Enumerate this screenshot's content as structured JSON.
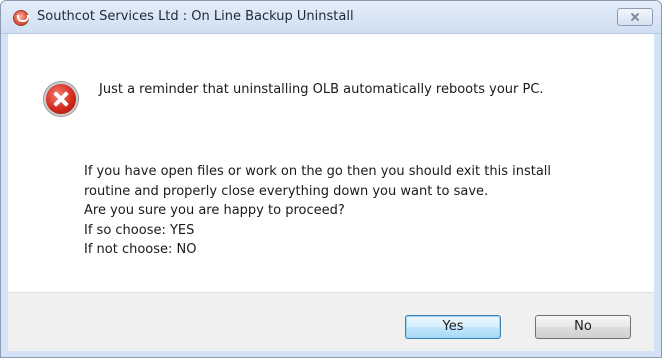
{
  "window": {
    "title": "Southcot Services Ltd : On Line Backup Uninstall",
    "icon": "app-icon"
  },
  "titlebar": {
    "close_icon": "close-icon"
  },
  "message": {
    "icon": "error-icon",
    "line1": "Just a reminder that uninstalling OLB automatically reboots your PC.",
    "lines": [
      "If you have open files or work on the go then you should exit this install",
      "routine and properly close everything down you want to save.",
      "Are you sure you are happy to proceed?",
      "If so choose:  YES",
      "If not choose:  NO"
    ]
  },
  "buttons": {
    "yes_label": "Yes",
    "no_label": "No"
  },
  "colors": {
    "titlebar": "#d3e2f4",
    "default_button_border": "#3c7fb1",
    "error_red": "#d42a1d"
  }
}
